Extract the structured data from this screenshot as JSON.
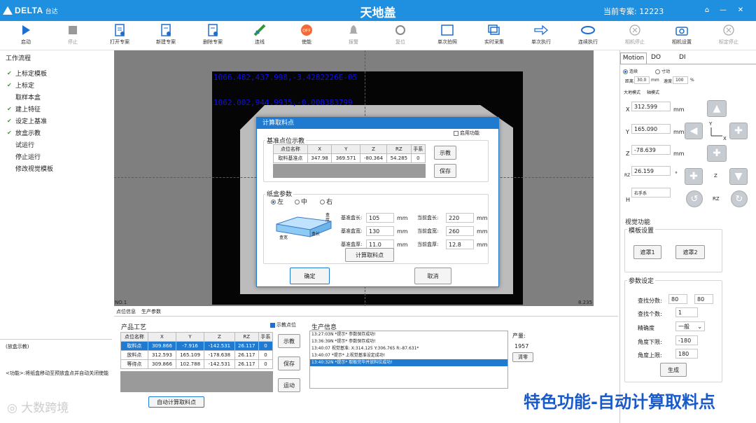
{
  "titlebar": {
    "brand": "DELTA",
    "brand_cn": "台达",
    "title": "天地盖",
    "project_label": "当前专案: 12223",
    "bg": "#1f8fe0"
  },
  "toolbar": [
    "启动",
    "停止",
    "打开专案",
    "新建专案",
    "删除专案",
    "连线",
    "使能",
    "报警",
    "复位",
    "单次拍照",
    "实时采集",
    "单次执行",
    "连续执行",
    "相机停止",
    "相机设置",
    "标定停止"
  ],
  "workflow": {
    "title": "工作流程",
    "items": [
      {
        "label": "上标定模板",
        "done": true
      },
      {
        "label": "上标定",
        "done": true
      },
      {
        "label": "取样本盒",
        "done": false
      },
      {
        "label": "建上特征",
        "done": true
      },
      {
        "label": "设定上基准",
        "done": true
      },
      {
        "label": "放盒示教",
        "done": true
      },
      {
        "label": "试运行",
        "done": false
      },
      {
        "label": "停止运行",
        "done": false
      },
      {
        "label": "修改视觉模板",
        "done": false
      }
    ],
    "hint_title": "(放盒示教)",
    "hint": "<功能>:将纸盒移动至预放盒点并自动关闭使能"
  },
  "camera": {
    "overlay1": "1066.482,437.998,-3.4282226E-05",
    "overlay2": "1062.002,944.9935,-0.008383799",
    "corner_left": "NO.1",
    "corner_right": "8.235"
  },
  "dialog": {
    "title": "计算取料点",
    "enable_label": "启用功能",
    "base_group": "基准点位示教",
    "table_headers": [
      "点位名称",
      "X",
      "Y",
      "Z",
      "RZ",
      "手系"
    ],
    "table_row": [
      "取料基准点",
      "347.98",
      "369.571",
      "-80.364",
      "54.285",
      "0"
    ],
    "teach_btn": "示教",
    "save_btn": "保存",
    "box_group": "纸盒参数",
    "radios": [
      "左",
      "中",
      "右"
    ],
    "fields": [
      {
        "label": "基准盒长:",
        "value": "105",
        "unit": "mm",
        "label2": "当前盒长:",
        "value2": "220",
        "unit2": "mm"
      },
      {
        "label": "基准盒宽:",
        "value": "130",
        "unit": "mm",
        "label2": "当前盒宽:",
        "value2": "260",
        "unit2": "mm"
      },
      {
        "label": "基准盒厚:",
        "value": "11.0",
        "unit": "mm",
        "label2": "当前盒厚:",
        "value2": "12.8",
        "unit2": "mm"
      }
    ],
    "diagram_labels": {
      "thick": "盒厚",
      "length": "盒长",
      "width": "盒宽"
    },
    "calc_btn": "计算取料点",
    "ok_btn": "确定",
    "cancel_btn": "取消"
  },
  "bottom": {
    "tabs": [
      "点位信息",
      "生产参数"
    ],
    "product_title": "产品工艺",
    "teach_check": "示教点位",
    "headers": [
      "点位名称",
      "X",
      "Y",
      "Z",
      "RZ",
      "手系"
    ],
    "rows": [
      [
        "取料点",
        "309.866",
        "-7.916",
        "-142.531",
        "26.117",
        "0"
      ],
      [
        "放料点",
        "312.593",
        "165.109",
        "-178.638",
        "26.117",
        "0"
      ],
      [
        "等待点",
        "309.866",
        "102.788",
        "-142.531",
        "26.117",
        "0"
      ]
    ],
    "teach_btn": "示教",
    "save_btn": "保存",
    "move_btn": "运动",
    "auto_btn": "自动计算取料点",
    "prod_title": "生产信息",
    "logs": [
      "13:27:03N *提示* 参数保存成功!",
      "13:36:39N *提示* 参数保存成功!",
      "13:40:07 视觉基准: X:314.125 Y:306.765 R:-87.631*",
      "13:40:07 *提示* 上视觉基准设定成功!",
      "13:40:32N *提示* 取板完毕并放料位成功!"
    ],
    "output_label": "产量:",
    "output_value": "1957",
    "clear_btn": "清零"
  },
  "right": {
    "tabs": [
      "Motion",
      "DO",
      "DI"
    ],
    "mode_radios": [
      "连续",
      "寸动"
    ],
    "dist_label": "距离",
    "dist_value": "30.0",
    "dist_unit": "mm",
    "speed_label": "速度",
    "speed_value": "100",
    "speed_unit": "%",
    "coord_labels": [
      "大地模式",
      "轴模式"
    ],
    "x_label": "X",
    "x_value": "312.599",
    "y_label": "Y",
    "y_value": "165.090",
    "z_label": "Z",
    "z_value": "-78.639",
    "rz_label": "RZ",
    "rz_value": "26.159",
    "h_label": "H",
    "h_value": "右手系",
    "unit": "mm",
    "deg": "°",
    "z_small": "Z",
    "rz_small": "RZ",
    "axis_y": "Y",
    "axis_x": "X",
    "vision_title": "视觉功能",
    "template_group": "模板设置",
    "mask1": "遮罩1",
    "mask2": "遮罩2",
    "param_group": "参数设定",
    "p_score": "查找分数:",
    "p_score_v1": "80",
    "p_score_v2": "80",
    "p_count": "查找个数:",
    "p_count_v": "1",
    "p_prec": "精确度",
    "p_prec_v": "一般",
    "p_angle_lo": "角度下限:",
    "p_angle_lo_v": "-180",
    "p_angle_hi": "角度上限:",
    "p_angle_hi_v": "180",
    "gen_btn": "生成"
  },
  "banner": "特色功能-自动计算取料点",
  "watermark": "大数跨境"
}
